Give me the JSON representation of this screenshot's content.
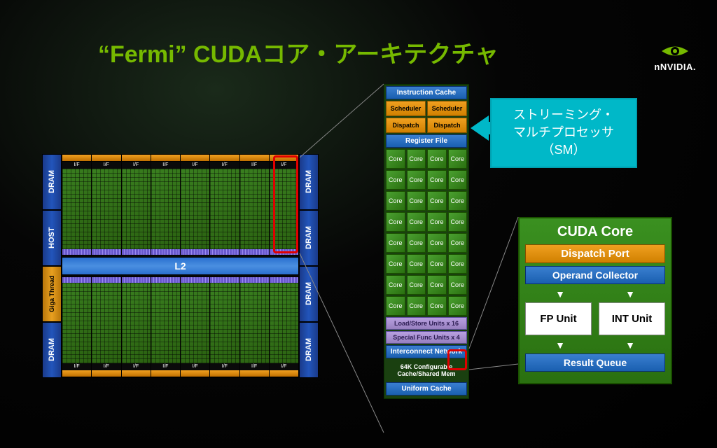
{
  "title": "“Fermi” CUDAコア・アーキテクチャ",
  "logo": {
    "text": "NVIDIA."
  },
  "chip": {
    "left_labels": [
      "DRAM",
      "HOST",
      "Giga Thread",
      "DRAM"
    ],
    "right_labels": [
      "DRAM",
      "DRAM",
      "DRAM",
      "DRAM"
    ],
    "if_label": "I/F",
    "l2": "L2"
  },
  "sm": {
    "instruction_cache": "Instruction Cache",
    "scheduler": "Scheduler",
    "dispatch": "Dispatch",
    "register_file": "Register File",
    "core": "Core",
    "core_rows": 8,
    "core_cols": 4,
    "load_store": "Load/Store Units x 16",
    "sfu": "Special Func Units x 4",
    "interconnect": "Interconnect Network",
    "cache_shared": "64K Configurable\nCache/Shared Mem",
    "uniform_cache": "Uniform Cache"
  },
  "callout": {
    "line1": "ストリーミング・",
    "line2": "マルチプロセッサ",
    "line3": "（SM）"
  },
  "cuda_core": {
    "title": "CUDA Core",
    "dispatch_port": "Dispatch Port",
    "operand_collector": "Operand Collector",
    "fp_unit": "FP Unit",
    "int_unit": "INT Unit",
    "result_queue": "Result Queue"
  }
}
